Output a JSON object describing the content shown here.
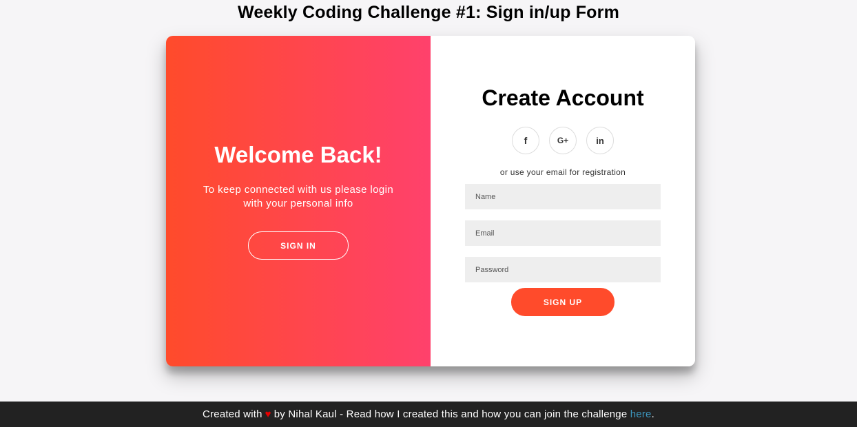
{
  "page": {
    "title": "Weekly Coding Challenge #1: Sign in/up Form"
  },
  "overlay": {
    "heading": "Welcome Back!",
    "text": "To keep connected with us please login with your personal info",
    "button_label": "SIGN IN",
    "gradient_from": "#ff4b2b",
    "gradient_to": "#ff416c"
  },
  "signup": {
    "heading": "Create Account",
    "social": [
      {
        "icon": "facebook-icon",
        "glyph": "f"
      },
      {
        "icon": "google-plus-icon",
        "glyph": "G+"
      },
      {
        "icon": "linkedin-icon",
        "glyph": "in"
      }
    ],
    "divider_text": "or use your email for registration",
    "fields": {
      "name": {
        "placeholder": "Name",
        "value": ""
      },
      "email": {
        "placeholder": "Email",
        "value": ""
      },
      "password": {
        "placeholder": "Password",
        "value": ""
      }
    },
    "button_label": "SIGN UP",
    "accent": "#ff4b2b"
  },
  "footer": {
    "prefix": "Created with",
    "heart": "♥",
    "middle": "by Nihal Kaul - Read how I created this and how you can join the challenge",
    "link_text": "here",
    "suffix": "."
  }
}
